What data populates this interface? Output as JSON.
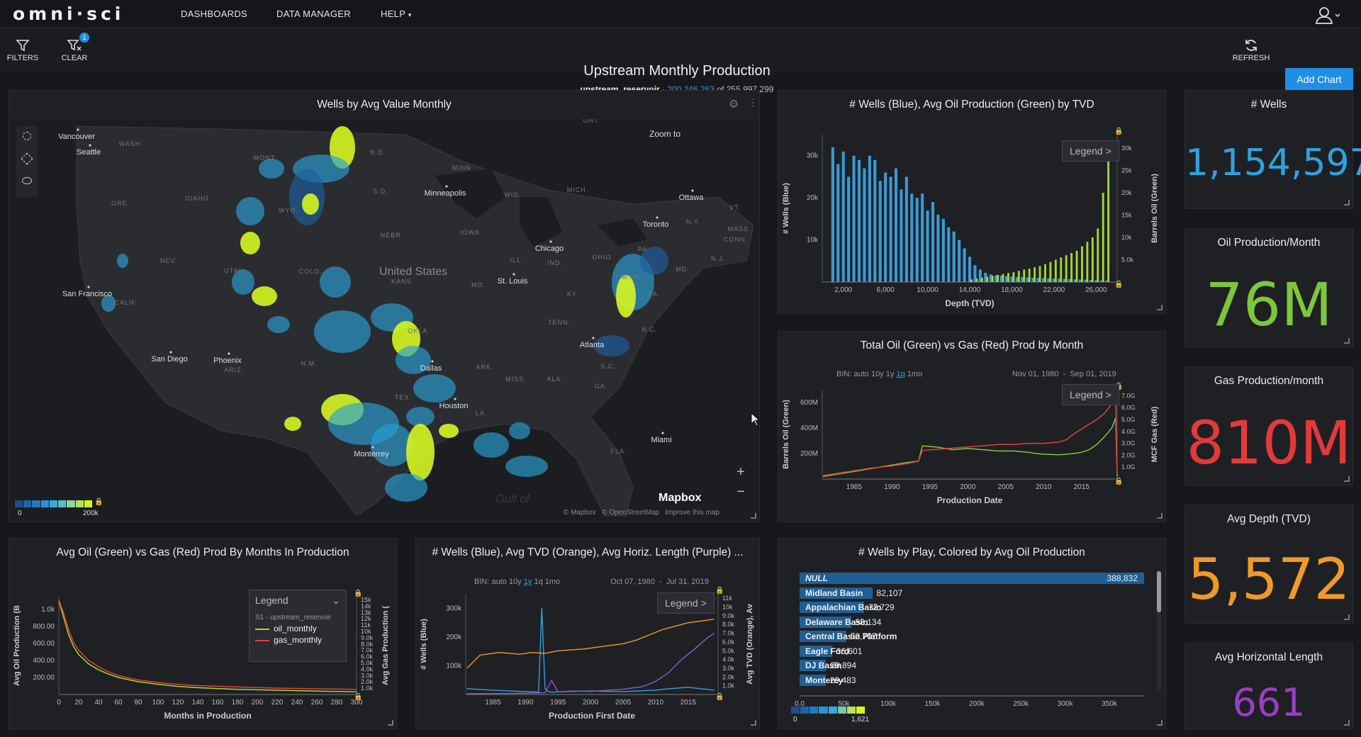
{
  "nav": {
    "logo": "omni·sci",
    "items": [
      "DASHBOARDS",
      "DATA MANAGER",
      "HELP"
    ]
  },
  "toolbar": {
    "filters_label": "FILTERS",
    "clear_label": "CLEAR",
    "clear_badge": "1",
    "refresh_label": "REFRESH",
    "add_chart_label": "Add Chart"
  },
  "dashboard": {
    "title": "Upstream Monthly Production",
    "source": "upstream_reservoir",
    "separator": "·",
    "count_filtered": "200,246,263",
    "count_of": "of",
    "count_total": "255,997,299"
  },
  "map": {
    "title": "Wells by Avg Value Monthly",
    "zoom_text": "Zoom to",
    "attribution": [
      "© Mapbox",
      "© OpenStreetMap",
      "Improve this map"
    ],
    "mapbox_logo": "Mapbox",
    "gulf": "Gulf of",
    "legend_min": "0",
    "legend_max": "200k",
    "country": "United States",
    "cities": [
      "Vancouver",
      "Seattle",
      "Minneapolis",
      "Ottawa",
      "Toronto",
      "Chicago",
      "San Francisco",
      "St. Louis",
      "Atlanta",
      "San Diego",
      "Phoenix",
      "Dallas",
      "Houston",
      "Miami",
      "Monterrey"
    ],
    "regions": [
      "WASH",
      "MONT",
      "N.D.",
      "MINN.",
      "ONT.",
      "IDAHO",
      "S.D.",
      "WIS.",
      "MICH.",
      "ORE.",
      "WYO.",
      "IOWA",
      "NEBR.",
      "N.Y.",
      "VT.",
      "MASS.",
      "CONN.",
      "NEV.",
      "UTAH",
      "COLO.",
      "KANS.",
      "MO.",
      "ILL.",
      "IND.",
      "OHIO",
      "PA.",
      "N.J.",
      "MD.",
      "CALIF.",
      "W.VA.",
      "VA.",
      "KY.",
      "TENN.",
      "N.C.",
      "ARIZ.",
      "N.M.",
      "OKLA.",
      "ARK.",
      "S.C.",
      "MISS.",
      "ALA.",
      "GA.",
      "TEX.",
      "LA.",
      "FLA."
    ],
    "colors": {
      "low": "#1d5fa0",
      "mid": "#2a9fd6",
      "high": "#d5f521"
    }
  },
  "kpis": [
    {
      "title": "# Wells",
      "value": "1,154,597",
      "color": "#2ea2e0"
    },
    {
      "title": "Oil Production/Month",
      "value": "76M",
      "color": "#7ec63a"
    },
    {
      "title": "Gas Production/month",
      "value": "810M",
      "color": "#e23a3a"
    },
    {
      "title": "Avg Depth (TVD)",
      "value": "5,572",
      "color": "#ef9a28"
    },
    {
      "title": "Avg Horizontal Length",
      "value": "661",
      "color": "#9b3ec4"
    }
  ],
  "tvd_chart": {
    "title": "# Wells (Blue), Avg Oil Production (Green) by TVD",
    "legend": "Legend",
    "chart_data": {
      "type": "bar",
      "xlabel": "Depth (TVD)",
      "ylabel_left": "# Wells (Blue)",
      "ylabel_right": "Barrels Oil (Green)",
      "x_ticks": [
        "2,000",
        "6,000",
        "10,000",
        "14,000",
        "18,000",
        "22,000",
        "26,000"
      ],
      "y_left_ticks": [
        "10k",
        "20k",
        "30k"
      ],
      "y_right_ticks": [
        "5.0k",
        "10k",
        "15k",
        "20k",
        "25k",
        "30k"
      ],
      "xlim": [
        0,
        28000
      ],
      "ylim_left": [
        0,
        35000
      ],
      "ylim_right": [
        0,
        33000
      ],
      "series": [
        {
          "name": "# Wells",
          "color": "#3a9ad6",
          "x": [
            1000,
            1500,
            2000,
            2500,
            3000,
            3500,
            4000,
            4500,
            5000,
            5500,
            6000,
            6500,
            7000,
            7500,
            8000,
            8500,
            9000,
            9500,
            10000,
            10500,
            11000,
            11500,
            12000,
            12500,
            13000,
            13500,
            14000,
            14500,
            15000,
            15500,
            16000,
            16500,
            17000,
            17500,
            18000,
            18500,
            19000,
            19500,
            20000,
            20500,
            21000,
            21500,
            22000,
            22500,
            23000,
            23500,
            24000,
            24500,
            25000,
            25500,
            26000,
            26500,
            27000
          ],
          "values": [
            32000,
            28000,
            31000,
            25000,
            30000,
            29000,
            27000,
            30000,
            29000,
            24000,
            26000,
            25000,
            27000,
            22000,
            25000,
            21000,
            20000,
            21000,
            17000,
            19000,
            16000,
            15000,
            13000,
            12000,
            10000,
            8000,
            6000,
            4000,
            3000,
            2200,
            1800,
            1600,
            1500,
            1400,
            1300,
            1200,
            1200,
            1100,
            1000,
            1000,
            950,
            900,
            850,
            800,
            750,
            700,
            650,
            600,
            550,
            500,
            450,
            400,
            350
          ]
        },
        {
          "name": "Avg Oil Production",
          "color": "#a4d63a",
          "x": [
            14000,
            14500,
            15000,
            15500,
            16000,
            16500,
            17000,
            17500,
            18000,
            18500,
            19000,
            19500,
            20000,
            20500,
            21000,
            21500,
            22000,
            22500,
            23000,
            23500,
            24000,
            24500,
            25000,
            25500,
            26000,
            26500,
            27000
          ],
          "values": [
            600,
            800,
            1000,
            1200,
            1400,
            1600,
            1800,
            2000,
            2200,
            2500,
            2800,
            3000,
            3300,
            3600,
            4000,
            4500,
            5000,
            5500,
            6000,
            6500,
            7000,
            8000,
            9000,
            10000,
            12000,
            20000,
            28000
          ]
        }
      ]
    }
  },
  "oilgas_chart": {
    "title": "Total Oil (Green) vs Gas (Red) Prod by Month",
    "bin_label": "BIN:",
    "bins": [
      "auto",
      "10y",
      "1y",
      "1q",
      "1mo"
    ],
    "bin_active": "1q",
    "range": "Nov 01, 1980  -  Sep 01, 2019",
    "legend": "Legend",
    "chart_data": {
      "type": "line",
      "xlabel": "Production Date",
      "ylabel_left": "Barrels Oil (Green)",
      "ylabel_right": "MCF Gas (Red)",
      "x_ticks": [
        "1985",
        "1990",
        "1995",
        "2000",
        "2005",
        "2010",
        "2015"
      ],
      "y_left_ticks": [
        "200M",
        "400M",
        "600M"
      ],
      "y_right_ticks": [
        "1.0G",
        "2.0G",
        "3.0G",
        "4.0G",
        "5.0G",
        "6.0G",
        "7.0G"
      ],
      "xlim": [
        1980.8,
        2019.7
      ],
      "ylim_left": [
        0,
        700
      ],
      "ylim_right": [
        0,
        7.5
      ],
      "series": [
        {
          "name": "Oil",
          "color": "#7ec63a",
          "x": [
            1980.9,
            1983,
            1985,
            1987,
            1990,
            1992,
            1993.5,
            1994,
            1996,
            1998,
            2000,
            2002,
            2004,
            2006,
            2008,
            2009,
            2010,
            2012,
            2014,
            2015,
            2016,
            2017,
            2018,
            2019,
            2019.5,
            2019.7
          ],
          "values": [
            20,
            40,
            60,
            80,
            110,
            130,
            140,
            260,
            250,
            230,
            240,
            230,
            220,
            220,
            210,
            200,
            195,
            190,
            200,
            210,
            230,
            270,
            330,
            400,
            480,
            20
          ]
        },
        {
          "name": "Gas",
          "color": "#e04040",
          "x": [
            1980.9,
            1983,
            1985,
            1987,
            1990,
            1992,
            1993.5,
            1994,
            1996,
            1998,
            2000,
            2002,
            2004,
            2006,
            2008,
            2010,
            2012,
            2013,
            2014,
            2015,
            2016,
            2017,
            2018,
            2019,
            2019.5,
            2019.7
          ],
          "values": [
            0.3,
            0.5,
            0.7,
            0.9,
            1.1,
            1.3,
            1.5,
            2.4,
            2.5,
            2.6,
            2.7,
            2.8,
            2.9,
            2.9,
            3.0,
            3.0,
            3.1,
            3.3,
            3.8,
            4.2,
            4.6,
            5.0,
            5.5,
            6.3,
            6.6,
            0.4
          ]
        }
      ]
    }
  },
  "months_chart": {
    "title": "Avg Oil (Green) vs Gas (Red) Prod By Months In Production",
    "legend": {
      "title": "Legend",
      "subtitle": "S1 - upstream_reservoir",
      "items": [
        {
          "label": "oil_monthly",
          "color": "#a4d63a"
        },
        {
          "label": "gas_monthly",
          "color": "#e04040"
        }
      ]
    },
    "chart_data": {
      "type": "line",
      "xlabel": "Months in Production",
      "ylabel_left": "Avg Oil Production (B",
      "ylabel_right": "Avg Gas Production (",
      "x_ticks": [
        "0",
        "20",
        "40",
        "60",
        "80",
        "100",
        "120",
        "140",
        "160",
        "180",
        "200",
        "220",
        "240",
        "260",
        "280",
        "300"
      ],
      "y_left_ticks": [
        "200.00",
        "400.00",
        "600.00",
        "800.00",
        "1.0k"
      ],
      "y_right_ticks": [
        "1.0k",
        "2.0k",
        "3.0k",
        "4.0k",
        "5.0k",
        "6.0k",
        "7.0k",
        "8.0k",
        "9.0k",
        "10k",
        "11k",
        "12k",
        "13k",
        "14k",
        "15k"
      ],
      "xlim": [
        0,
        300
      ],
      "ylim_left": [
        0,
        1150
      ],
      "ylim_right": [
        0,
        15500
      ],
      "series": [
        {
          "name": "oil_monthly",
          "color": "#a4d63a",
          "x": [
            0,
            5,
            10,
            15,
            20,
            30,
            40,
            50,
            60,
            80,
            100,
            120,
            140,
            160,
            180,
            200,
            220,
            240,
            260,
            280,
            300
          ],
          "values": [
            1100,
            900,
            700,
            560,
            470,
            360,
            290,
            240,
            200,
            150,
            120,
            95,
            80,
            70,
            60,
            55,
            50,
            45,
            40,
            35,
            30
          ]
        },
        {
          "name": "gas_monthly",
          "color": "#e04040",
          "x": [
            0,
            5,
            10,
            15,
            20,
            30,
            40,
            50,
            60,
            80,
            100,
            120,
            140,
            160,
            180,
            200,
            220,
            240,
            260,
            280,
            300
          ],
          "values": [
            15000,
            12800,
            10200,
            8200,
            7000,
            5400,
            4400,
            3600,
            3000,
            2300,
            1900,
            1600,
            1400,
            1300,
            1200,
            1100,
            1000,
            950,
            900,
            850,
            800
          ]
        }
      ]
    }
  },
  "wells_date_chart": {
    "title": "# Wells (Blue), Avg TVD (Orange), Avg Horiz. Length (Purple) ...",
    "bin_label": "BIN:",
    "bins": [
      "auto",
      "10y",
      "1y",
      "1q",
      "1mo"
    ],
    "bin_active": "1y",
    "range": "Oct 07, 1980  -  Jul 31, 2019",
    "legend": "Legend",
    "chart_data": {
      "type": "line",
      "xlabel": "Production First Date",
      "ylabel_left": "# Wells (Blue)",
      "ylabel_right": "Avg TVD (Orange), Av",
      "x_ticks": [
        "1985",
        "1990",
        "1995",
        "2000",
        "2005",
        "2010",
        "2015"
      ],
      "y_left_ticks": [
        "100k",
        "200k",
        "300k"
      ],
      "y_right_ticks": [
        "1.0k",
        "2.0k",
        "3.0k",
        "4.0k",
        "5.0k",
        "6.0k",
        "7.0k",
        "8.0k",
        "9.0k",
        "10k",
        "11k"
      ],
      "xlim": [
        1980.8,
        2019.6
      ],
      "ylim_left": [
        0,
        350
      ],
      "ylim_right": [
        0,
        11500
      ],
      "series": [
        {
          "name": "# Wells",
          "color": "#2ea2e0",
          "x": [
            1981,
            1985,
            1990,
            1992,
            1992.5,
            1993,
            1993.5,
            1994,
            1996,
            2000,
            2005,
            2010,
            2012,
            2015,
            2017,
            2019
          ],
          "values": [
            20,
            15,
            10,
            8,
            300,
            20,
            10,
            8,
            10,
            12,
            10,
            15,
            20,
            25,
            20,
            15
          ]
        },
        {
          "name": "Avg TVD",
          "color": "#ef9a28",
          "x": [
            1981,
            1983,
            1986,
            1989,
            1991,
            1993,
            1995,
            1997,
            1999,
            2001,
            2003,
            2005,
            2007,
            2009,
            2011,
            2013,
            2015,
            2017,
            2019
          ],
          "values": [
            3000,
            4500,
            4800,
            4600,
            4800,
            4700,
            5000,
            5100,
            5200,
            5400,
            5600,
            5800,
            6200,
            6800,
            7400,
            7800,
            8200,
            8400,
            8600
          ]
        },
        {
          "name": "Avg Horiz. Length",
          "color": "#8a5ad0",
          "x": [
            1981,
            1985,
            1990,
            1993,
            1994,
            1995,
            1997,
            2000,
            2005,
            2008,
            2010,
            2012,
            2014,
            2016,
            2018,
            2019
          ],
          "values": [
            100,
            100,
            150,
            200,
            1600,
            300,
            400,
            350,
            600,
            900,
            1500,
            2500,
            4000,
            5200,
            6500,
            7000
          ]
        }
      ]
    }
  },
  "play_chart": {
    "title": "# Wells by Play, Colored by Avg Oil Production",
    "legend_min": "0",
    "legend_max": "1,621",
    "chart_data": {
      "type": "bar",
      "orientation": "horizontal",
      "x_ticks": [
        "0.0",
        "50k",
        "100k",
        "150k",
        "200k",
        "250k",
        "300k",
        "350k"
      ],
      "xlim": [
        0,
        390000
      ],
      "categories": [
        "NULL",
        "Midland Basin",
        "Appalachian Basin",
        "Delaware Basin",
        "Central Basin Platform",
        "Eagle Ford",
        "DJ Basin",
        "Monterey"
      ],
      "values": [
        388832,
        82107,
        72729,
        58134,
        52707,
        36601,
        29894,
        29483
      ],
      "value_labels": [
        "388,832",
        "82,107",
        "72,729",
        "58,134",
        "52,707",
        "36,601",
        "29,894",
        "29,483"
      ]
    }
  }
}
